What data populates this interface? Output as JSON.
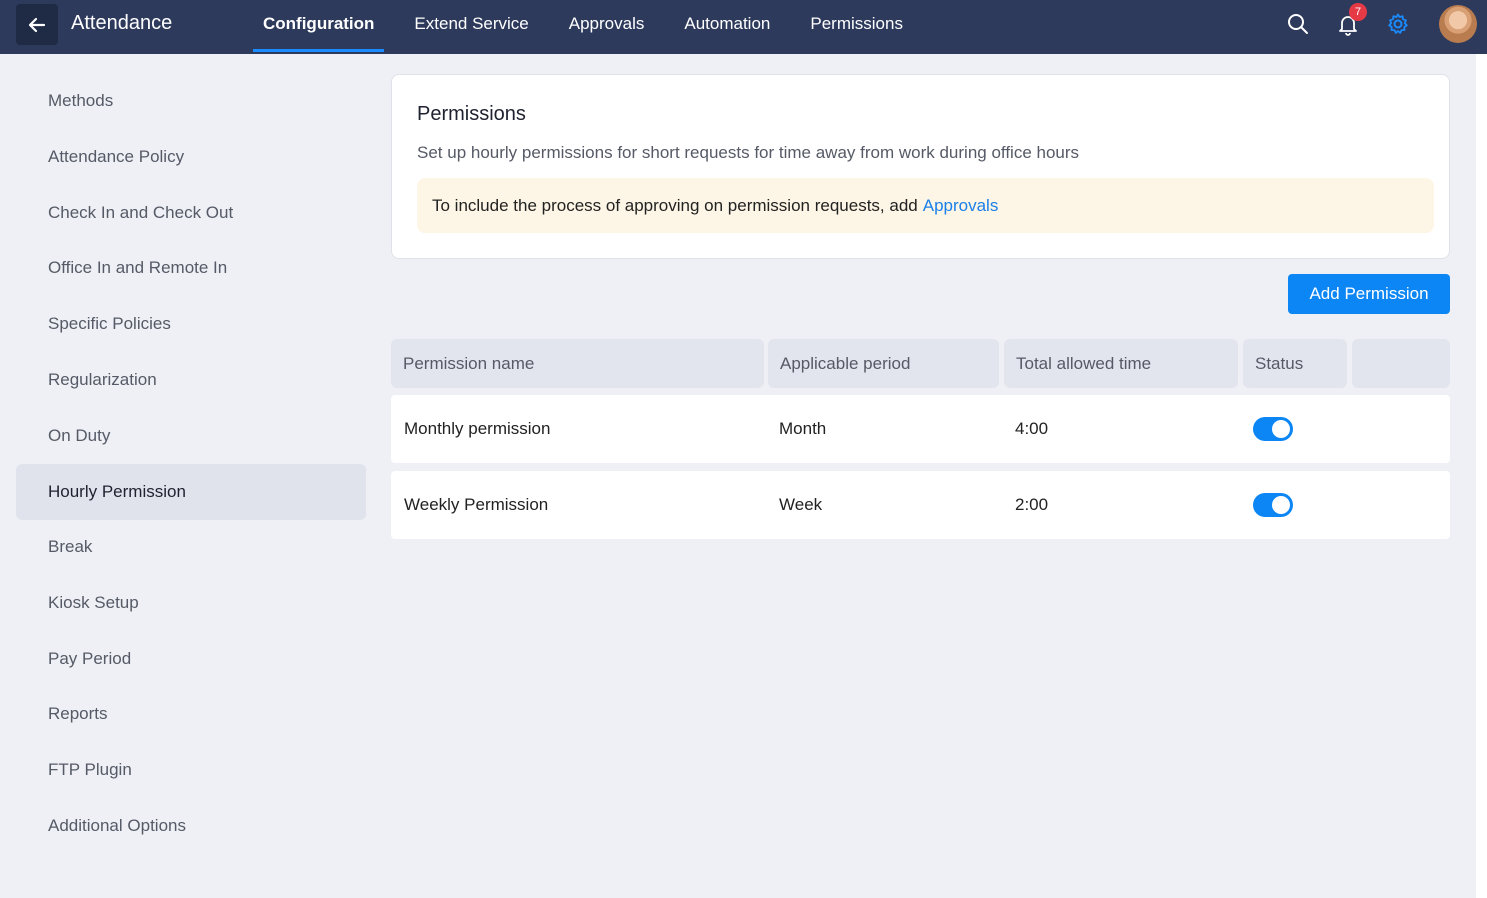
{
  "header": {
    "title": "Attendance",
    "tabs": [
      {
        "label": "Configuration",
        "active": true
      },
      {
        "label": "Extend Service"
      },
      {
        "label": "Approvals"
      },
      {
        "label": "Automation"
      },
      {
        "label": "Permissions"
      }
    ],
    "notification_count": "7",
    "icons": [
      "back-arrow-icon",
      "search-icon",
      "bell-icon",
      "gear-icon"
    ],
    "accent_color": "#1a8cff",
    "bar_color": "#2d3a5c"
  },
  "sidebar": {
    "items": [
      {
        "label": "Methods"
      },
      {
        "label": "Attendance Policy"
      },
      {
        "label": "Check In and Check Out"
      },
      {
        "label": "Office In and Remote In"
      },
      {
        "label": "Specific Policies"
      },
      {
        "label": "Regularization"
      },
      {
        "label": "On Duty"
      },
      {
        "label": "Hourly Permission",
        "active": true
      },
      {
        "label": "Break"
      },
      {
        "label": "Kiosk Setup"
      },
      {
        "label": "Pay Period"
      },
      {
        "label": "Reports"
      },
      {
        "label": "FTP Plugin"
      },
      {
        "label": "Additional Options"
      }
    ]
  },
  "main": {
    "card": {
      "title": "Permissions",
      "description": "Set up hourly permissions for short requests for time away from work during office hours",
      "note": "To include the process of approving on permission requests, add",
      "note_link": "Approvals"
    },
    "add_button": "Add Permission",
    "table": {
      "headers": [
        "Permission name",
        "Applicable period",
        "Total allowed time",
        "Status",
        ""
      ],
      "rows": [
        {
          "name": "Monthly permission",
          "period": "Month",
          "time": "4:00",
          "status_on": true
        },
        {
          "name": "Weekly Permission",
          "period": "Week",
          "time": "2:00",
          "status_on": true
        }
      ]
    }
  }
}
